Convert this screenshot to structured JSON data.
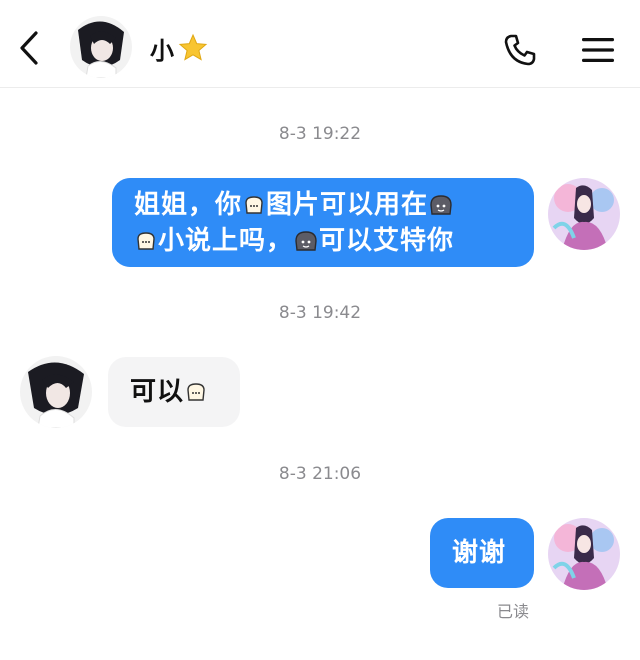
{
  "header": {
    "contact_name": "小",
    "back_icon": "chevron-left-icon",
    "call_icon": "phone-icon",
    "menu_icon": "hamburger-menu-icon",
    "badge_icon": "star-icon"
  },
  "messages": [
    {
      "time": "8-3  19:22",
      "direction": "out",
      "segments": [
        "姐姐，你",
        "图片可以用在",
        "",
        "小说上吗，",
        "可以艾特你"
      ]
    },
    {
      "time": "8-3  19:42",
      "direction": "in",
      "segments": [
        "可以"
      ]
    },
    {
      "time": "8-3  21:06",
      "direction": "out",
      "segments": [
        "谢谢"
      ],
      "status": "已读"
    }
  ],
  "colors": {
    "outgoing_bubble": "#2f8cf7",
    "incoming_bubble": "#f4f4f5",
    "timestamp": "#8a8a8e"
  }
}
